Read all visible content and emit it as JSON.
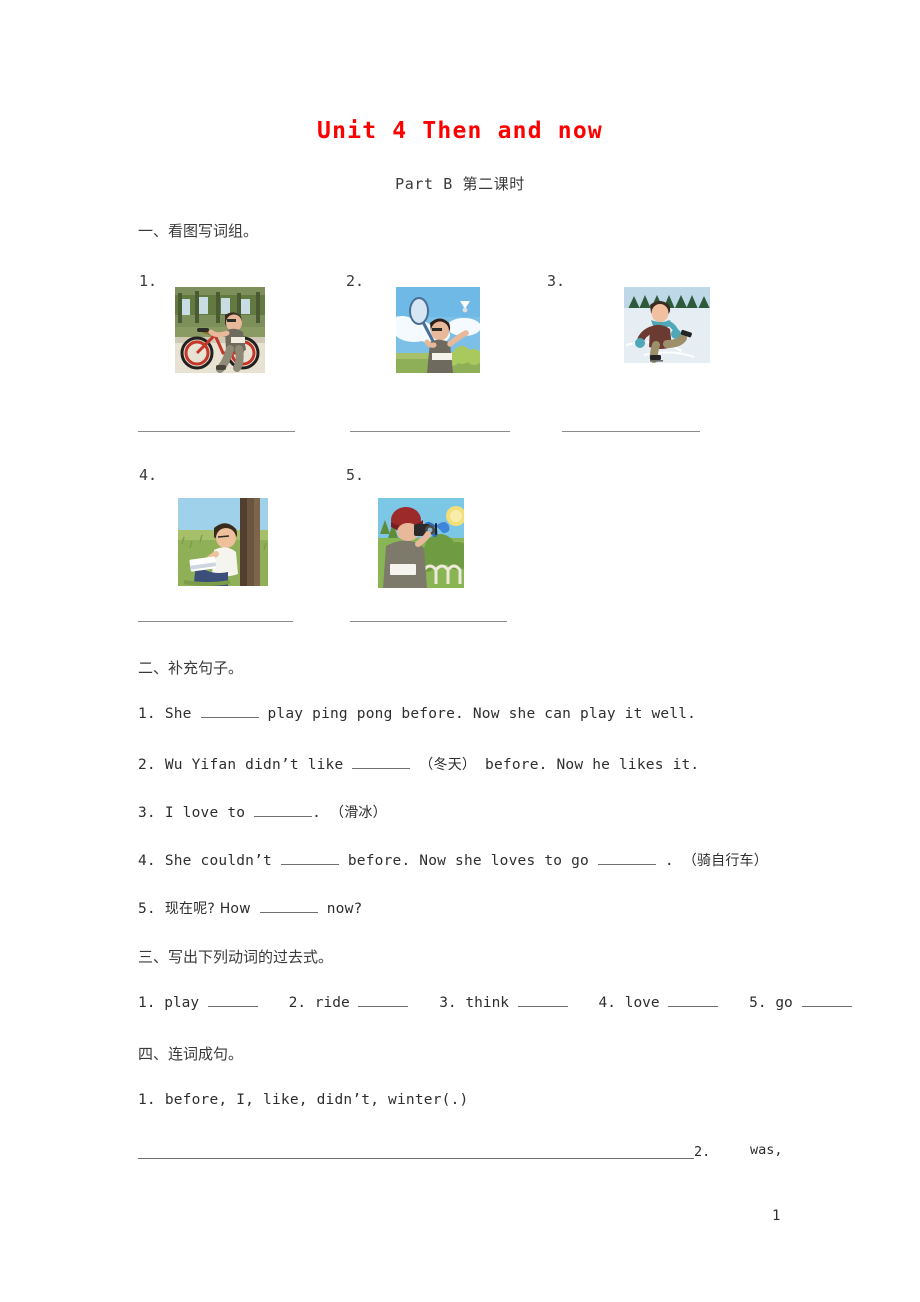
{
  "document": {
    "title": "Unit 4 Then and now",
    "subtitle": "Part B 第二课时",
    "title_color": "#ff0000",
    "page_number": "1"
  },
  "section_one": {
    "heading": "一、看图写词组。",
    "items": [
      {
        "number": "1.",
        "picture": "boy-riding-bicycle-icon"
      },
      {
        "number": "2.",
        "picture": "boy-playing-badminton-icon"
      },
      {
        "number": "3.",
        "picture": "boy-ice-skating-icon"
      },
      {
        "number": "4.",
        "picture": "boy-reading-book-under-tree-icon"
      },
      {
        "number": "5.",
        "picture": "person-taking-photo-butterfly-icon"
      }
    ]
  },
  "section_two": {
    "heading": "二、补充句子。",
    "questions": [
      {
        "number": "1.",
        "before": "She",
        "after": "play ping pong before. Now she can play it well.",
        "hint": ""
      },
      {
        "number": "2.",
        "before": "Wu Yifan didn’t like",
        "after": "before. Now he likes it.",
        "hint": "（冬天）"
      },
      {
        "number": "3.",
        "before": "I love to",
        "after": ".",
        "hint": "（滑冰）"
      },
      {
        "number": "4.",
        "before": "She couldn’t",
        "mid": "before. Now she loves to go",
        "after": ".",
        "hint": "（骑自行车）"
      },
      {
        "number": "5.",
        "before": "现在呢? How",
        "after": "now?",
        "hint": ""
      }
    ]
  },
  "section_three": {
    "heading": "三、写出下列动词的过去式。",
    "verbs": [
      {
        "number": "1.",
        "word": "play"
      },
      {
        "number": "2.",
        "word": "ride"
      },
      {
        "number": "3.",
        "word": "think"
      },
      {
        "number": "4.",
        "word": "love"
      },
      {
        "number": "5.",
        "word": "go"
      }
    ]
  },
  "section_four": {
    "heading": "四、连词成句。",
    "questions": [
      {
        "number": "1.",
        "words": "before, I, like, didn’t, winter(.)"
      }
    ],
    "tail_number": "2.",
    "tail_words": "was,"
  }
}
